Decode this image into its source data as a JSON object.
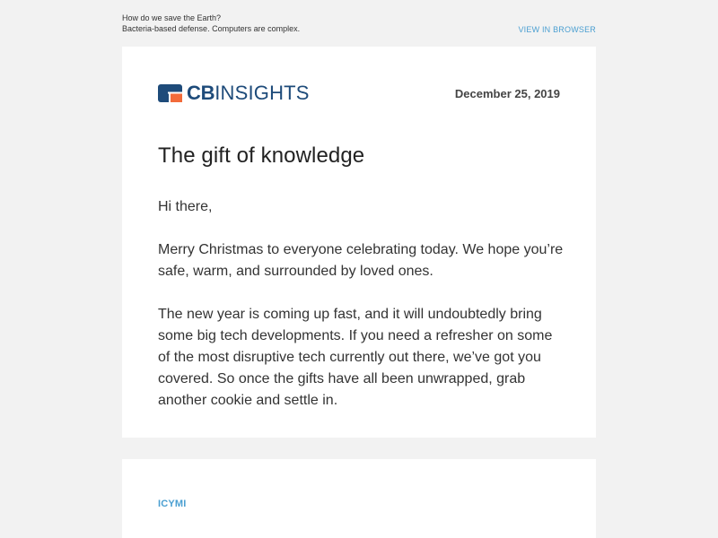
{
  "preheader": {
    "line1": "How do we save the Earth?",
    "line2": "Bacteria-based defense. Computers are complex.",
    "view_in_browser": "VIEW IN BROWSER"
  },
  "header": {
    "logo_cb": "CB",
    "logo_insights": "INSIGHTS",
    "date": "December 25, 2019"
  },
  "main": {
    "headline": "The gift of knowledge",
    "greeting": "Hi there,",
    "paragraph1": "Merry Christmas to everyone celebrating today. We hope you’re safe, warm, and surrounded by loved ones.",
    "paragraph2": "The new year is coming up fast, and it will undoubtedly bring some big tech developments. If you need a refresher on some of the most disruptive tech currently out there, we’ve got you covered. So once the gifts have all been unwrapped, grab another cookie and settle in."
  },
  "section2": {
    "label": "ICYMI"
  },
  "colors": {
    "background": "#f2f2f2",
    "card": "#ffffff",
    "brand_navy": "#1e4b7a",
    "brand_orange": "#f26b3a",
    "link_blue": "#4a9fd1"
  },
  "icons": {
    "logo_mark": "cb-insights-logo-mark"
  }
}
